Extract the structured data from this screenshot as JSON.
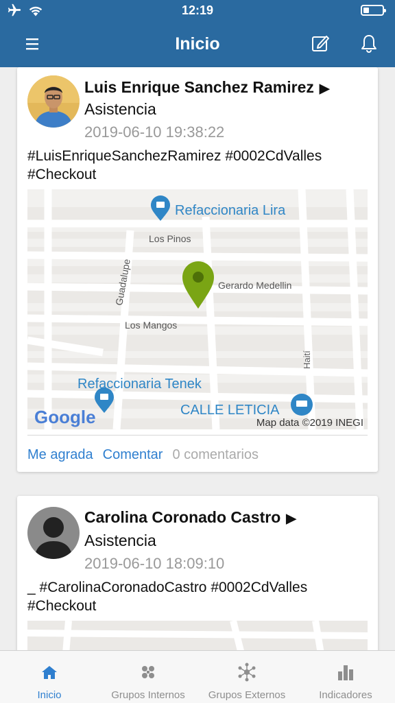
{
  "status_bar": {
    "time": "12:19",
    "battery_level": 0.3
  },
  "header": {
    "title": "Inicio"
  },
  "posts": [
    {
      "author": "Luis Enrique Sanchez Ramirez",
      "arrow": "▶",
      "type": "Asistencia",
      "datetime": "2019-06-10 19:38:22",
      "hashtags": "#LuisEnriqueSanchezRamirez #0002CdValles #Checkout",
      "map": {
        "labels": {
          "poi1": "Refaccionaria Lira",
          "poi2": "Refaccionaria Tenek",
          "poi3": "CALLE LETICIA",
          "street1": "Los Pinos",
          "street2": "Guadalupe",
          "street3": "Gerardo Medellin",
          "street4": "Los Mangos",
          "street5": "Haití"
        },
        "logo": "Google",
        "attribution": "Map data ©2019 INEGI"
      },
      "actions": {
        "like": "Me agrada",
        "comment": "Comentar",
        "comments_count": "0 comentarios"
      }
    },
    {
      "author": "Carolina Coronado Castro",
      "arrow": "▶",
      "type": "Asistencia",
      "datetime": "2019-06-10 18:09:10",
      "hashtags": "_ #CarolinaCoronadoCastro #0002CdValles #Checkout"
    }
  ],
  "tabs": [
    {
      "label": "Inicio",
      "icon": "home-icon",
      "active": true
    },
    {
      "label": "Grupos Internos",
      "icon": "groups-internal-icon",
      "active": false
    },
    {
      "label": "Grupos Externos",
      "icon": "groups-external-icon",
      "active": false
    },
    {
      "label": "Indicadores",
      "icon": "bar-chart-icon",
      "active": false
    }
  ],
  "colors": {
    "primary": "#2a6aa0",
    "accent": "#2f7fcf",
    "pin": "#7aa514",
    "muted": "#999999"
  }
}
